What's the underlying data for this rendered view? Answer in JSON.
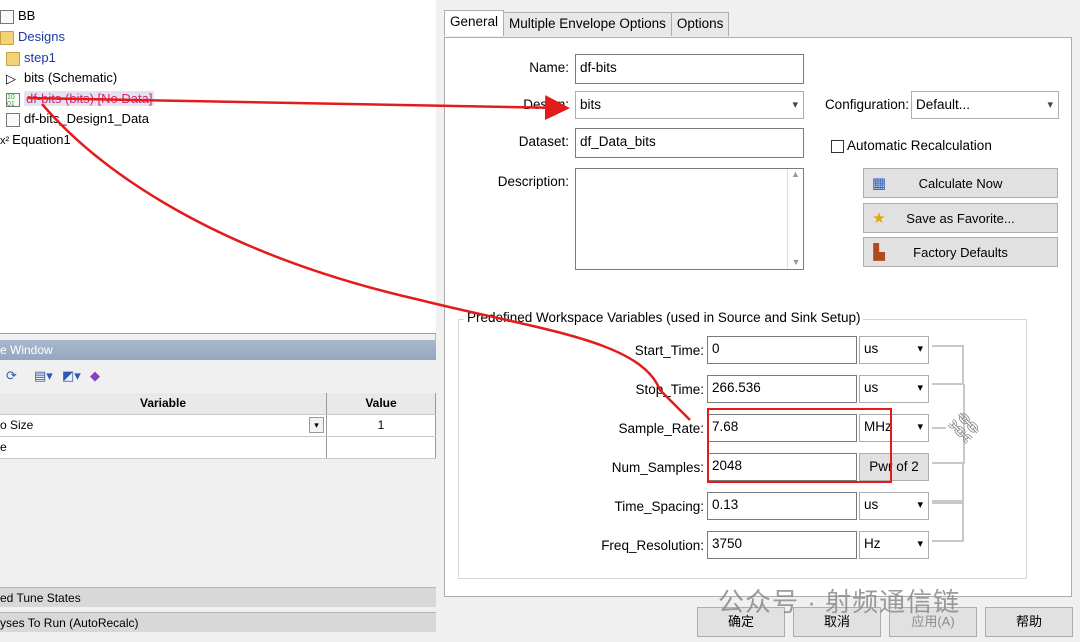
{
  "tree": {
    "nodes": [
      {
        "label": "BB"
      },
      {
        "label": "Designs"
      },
      {
        "label": "step1"
      },
      {
        "label": "bits (Schematic)"
      },
      {
        "label": "df-bits (bits) [No Data]"
      },
      {
        "label": "df-bits_Design1_Data"
      },
      {
        "label": "Equation1"
      }
    ],
    "equation_icon_text": "x²"
  },
  "var_window": {
    "title": "e Window",
    "headers": [
      "Variable",
      "Value"
    ],
    "rows": [
      {
        "variable": "o Size",
        "value": "1"
      },
      {
        "variable": "e",
        "value": ""
      }
    ]
  },
  "left_status": {
    "tune_states": "ed Tune States",
    "analyses": "yses To Run (AutoRecalc)"
  },
  "tabs": [
    "General",
    "Multiple Envelope Options",
    "Options"
  ],
  "general": {
    "name_label": "Name:",
    "name_value": "df-bits",
    "design_label": "Design:",
    "design_value": "bits",
    "config_label": "Configuration:",
    "config_value": "Default...",
    "dataset_label": "Dataset:",
    "dataset_value": "df_Data_bits",
    "auto_recalc_label": "Automatic Recalculation",
    "description_label": "Description:",
    "description_value": "",
    "buttons": {
      "calculate": "Calculate Now",
      "favorite": "Save as Favorite...",
      "factory": "Factory Defaults"
    }
  },
  "workspace": {
    "legend": "Predefined Workspace Variables (used in Source and Sink Setup)",
    "rows": [
      {
        "label": "Start_Time:",
        "value": "0",
        "unit": "us"
      },
      {
        "label": "Stop_Time:",
        "value": "266.536",
        "unit": "us"
      },
      {
        "label": "Sample_Rate:",
        "value": "7.68",
        "unit": "MHz"
      },
      {
        "label": "Num_Samples:",
        "value": "2048",
        "unit": "Pwr of 2"
      },
      {
        "label": "Time_Spacing:",
        "value": "0.13",
        "unit": "us"
      },
      {
        "label": "Freq_Resolution:",
        "value": "3750",
        "unit": "Hz"
      }
    ]
  },
  "dialog_buttons": {
    "ok": "确定",
    "cancel": "取消",
    "apply": "应用(A)",
    "help": "帮助"
  },
  "watermark": "公众号 · 射频通信链",
  "colors": {
    "annotation_red": "#e21b1b",
    "nodata_pink": "#d6266b",
    "link_blue": "#1a3aa5"
  }
}
